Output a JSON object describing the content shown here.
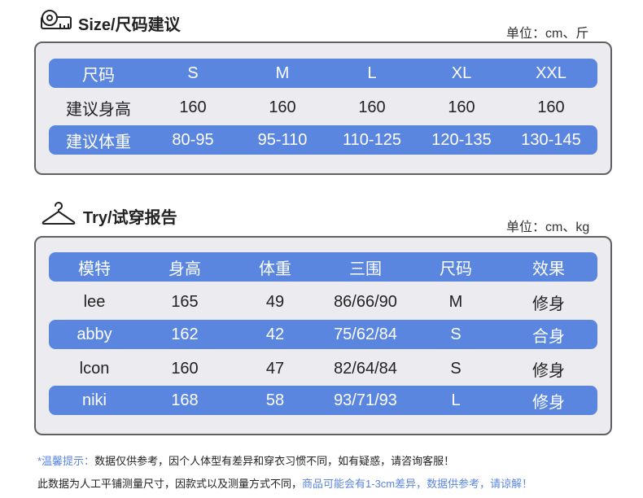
{
  "size_section": {
    "title": "Size/尺码建议",
    "unit": "单位：cm、斤",
    "icon": "tape-measure-icon",
    "header": [
      "尺码",
      "S",
      "M",
      "L",
      "XL",
      "XXL"
    ],
    "rows": [
      [
        "建议身高",
        "160",
        "160",
        "160",
        "160",
        "160"
      ],
      [
        "建议体重",
        "80-95",
        "95-110",
        "110-125",
        "120-135",
        "130-145"
      ]
    ]
  },
  "try_section": {
    "title": "Try/试穿报告",
    "unit": "单位：cm、kg",
    "icon": "hanger-icon",
    "header": [
      "模特",
      "身高",
      "体重",
      "三围",
      "尺码",
      "效果"
    ],
    "rows": [
      [
        "lee",
        "165",
        "49",
        "86/66/90",
        "M",
        "修身"
      ],
      [
        "abby",
        "162",
        "42",
        "75/62/84",
        "S",
        "合身"
      ],
      [
        "lcon",
        "160",
        "47",
        "82/64/84",
        "S",
        "修身"
      ],
      [
        "niki",
        "168",
        "58",
        "93/71/93",
        "L",
        "修身"
      ]
    ]
  },
  "notes": {
    "line1_prefix": "*温馨提示：",
    "line1_text": "数据仅供参考，因个人体型有差异和穿衣习惯不同，如有疑惑，请咨询客服！",
    "line2_text": "此数据为人工平铺测量尺寸，因款式以及测量方式不同，",
    "line2_highlight": "商品可能会有1-3cm差异，数据供参考，请谅解！"
  },
  "colors": {
    "accent_blue": "#5b86e0",
    "panel_bg": "#ececf0",
    "panel_border": "#5f5f66"
  }
}
